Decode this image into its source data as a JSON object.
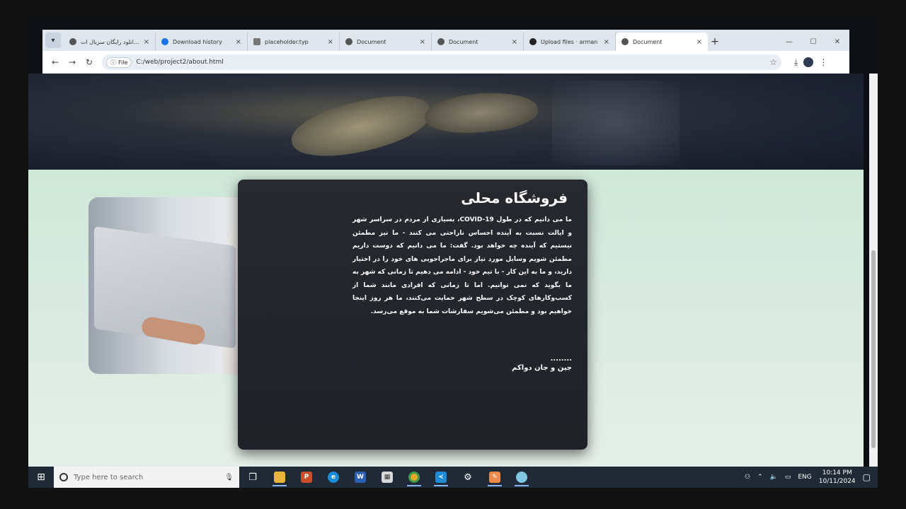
{
  "browser": {
    "tabs": [
      {
        "title": "دانلود رایگان سریال ات...",
        "active": false
      },
      {
        "title": "Download history",
        "active": false
      },
      {
        "title": "placeholder.typ",
        "active": false
      },
      {
        "title": "Document",
        "active": false
      },
      {
        "title": "Document",
        "active": false
      },
      {
        "title": "Upload files · arman",
        "active": false
      },
      {
        "title": "Document",
        "active": true
      }
    ],
    "new_tab": "+",
    "address": {
      "chip": "File",
      "url": "C:/web/project2/about.html"
    }
  },
  "page": {
    "card": {
      "title": "فروشگاه محلی",
      "body": "ما می دانیم که در طول COVID-19، بسیاری از مردم در سراسر شهر و ایالت نسبت به آینده احساس ناراحتی می کنند - ما نیز مطمئن نیستیم که آینده چه خواهد بود. گفت: ما می دانیم که دوست داریم مطمئن شویم وسایل مورد نیاز برای ماجراجویی های خود را در اختیار دارید، و ما به این کار - با تیم خود - ادامه می دهیم تا زمانی که شهر به ما بگوید که نمی توانیم. اما تا زمانی که افرادی مانند شما از کسب‌وکارهای کوچک در سطح شهر حمایت می‌کنند، ما هر روز اینجا خواهیم بود و مطمئن می‌شویم سفارشات شما به موقع می‌رسد.",
      "dots": "........",
      "signature": "جین و جان دواکم"
    }
  },
  "taskbar": {
    "search_placeholder": "Type here to search",
    "lang": "ENG",
    "time": "10:14 PM",
    "date": "10/11/2024"
  },
  "colors": {
    "page_bg": "#cfe7d8",
    "card_bg": "#23262b",
    "taskbar_bg": "#1f2a36"
  }
}
